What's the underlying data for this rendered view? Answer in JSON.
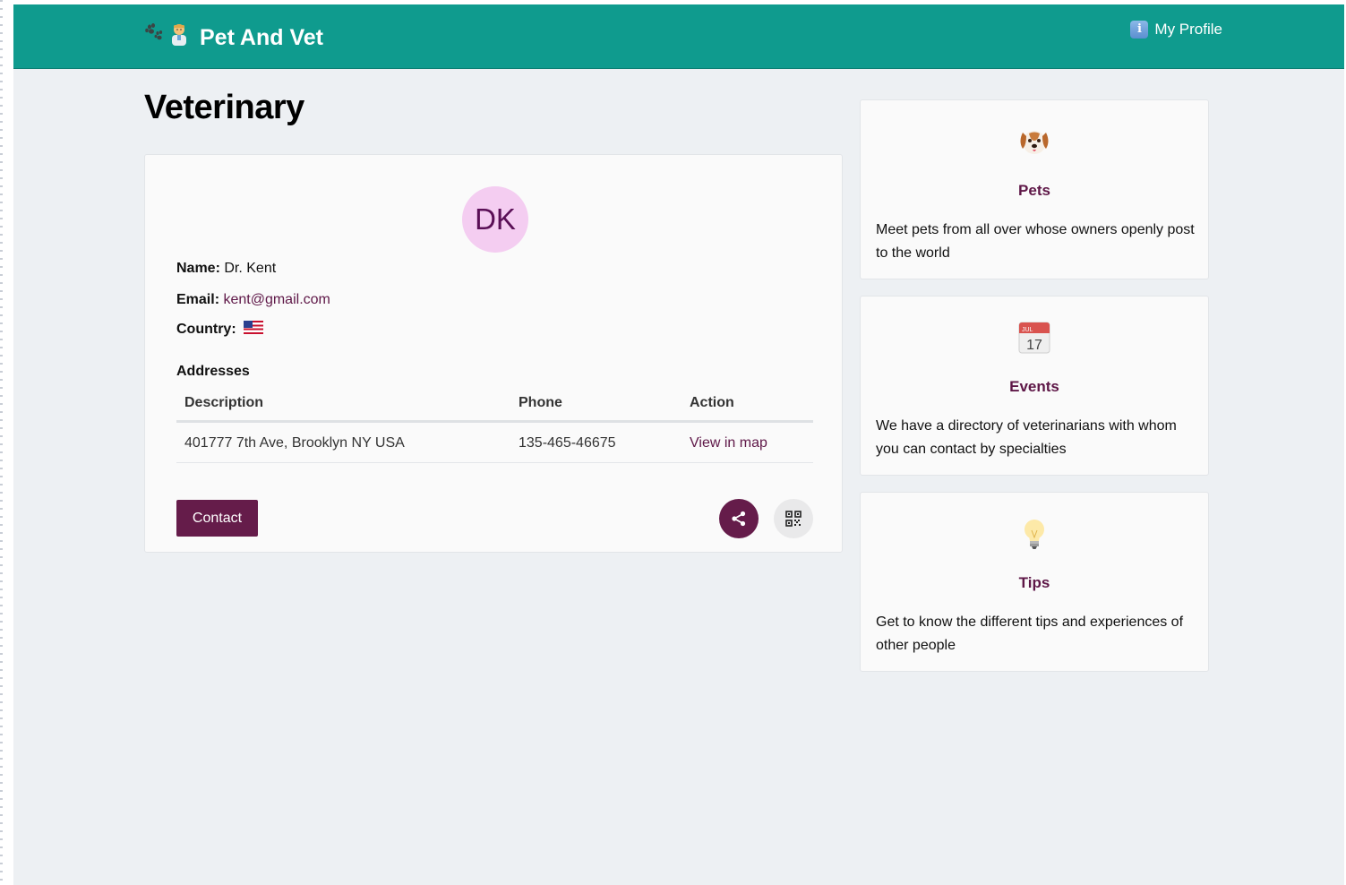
{
  "navbar": {
    "brand_title": "Pet And Vet",
    "profile_label": "My Profile",
    "info_glyph": "i",
    "background_color": "#0f9b8e"
  },
  "page": {
    "title": "Veterinary"
  },
  "vet": {
    "avatar_initials": "DK",
    "name_label": "Name:",
    "name": "Dr. Kent",
    "email_label": "Email:",
    "email": "kent@gmail.com",
    "country_label": "Country:",
    "country_flag": "us-flag-icon",
    "addresses_title": "Addresses",
    "table": {
      "headers": [
        "Description",
        "Phone",
        "Action"
      ],
      "rows": [
        {
          "description": "401777 7th Ave, Brooklyn NY USA",
          "phone": "135-465-46675",
          "action": "View in map"
        }
      ]
    },
    "contact_label": "Contact",
    "accent_color": "#651c4a"
  },
  "sidebar": {
    "cards": [
      {
        "icon": "dog-face-icon",
        "title": "Pets",
        "text": "Meet pets from all over whose owners openly post to the world"
      },
      {
        "icon": "calendar-icon",
        "calendar_month": "JUL",
        "calendar_day": "17",
        "title": "Events",
        "text": "We have a directory of veterinarians with whom you can contact by specialties"
      },
      {
        "icon": "light-bulb-icon",
        "title": "Tips",
        "text": "Get to know the different tips and experiences of other people"
      }
    ]
  }
}
